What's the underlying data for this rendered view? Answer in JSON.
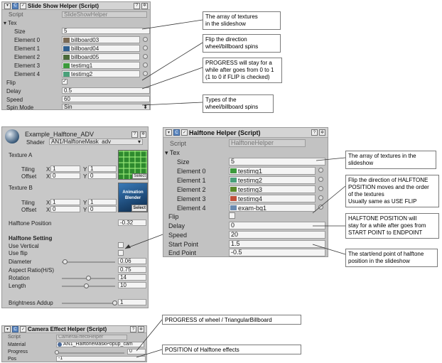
{
  "slideshow": {
    "title": "Slide Show Helper (Script)",
    "script_label": "Script",
    "script_value": "SlideShowHelper",
    "tex_label": "Tex",
    "size_label": "Size",
    "size_value": "5",
    "elements": [
      {
        "label": "Element 0",
        "value": "billboard03",
        "color": "#7b6a55"
      },
      {
        "label": "Element 1",
        "value": "billboard04",
        "color": "#2f5f8f"
      },
      {
        "label": "Element 2",
        "value": "billboard05",
        "color": "#4a6a3a"
      },
      {
        "label": "Element 3",
        "value": "testimg1",
        "color": "#3c9a3c"
      },
      {
        "label": "Element 4",
        "value": "testimg2",
        "color": "#4aa07a"
      }
    ],
    "flip_label": "Flip",
    "flip_checked": "✓",
    "delay_label": "Delay",
    "delay_value": "0.5",
    "speed_label": "Speed",
    "speed_value": "60",
    "spin_label": "Spin Mode",
    "spin_value": "Sin"
  },
  "notes_top": {
    "textures": [
      "The array of textures",
      "in the slideshow"
    ],
    "flip": [
      "Flip the direction",
      "wheel/billboard spins"
    ],
    "progress": [
      "PROGRESS will stay for a",
      "while after goes from 0 to 1",
      "(1 to 0 if FLIP is checked)"
    ],
    "types": [
      "Types of the",
      "wheel/billboard spins"
    ]
  },
  "material": {
    "name": "Example_Halftone_ADV",
    "shader_label": "Shader",
    "shader_value": "AN1/HalftoneMask_adv",
    "texA_label": "Texture A",
    "texB_label": "Texture B",
    "tiling_label": "Tiling",
    "offset_label": "Offset",
    "x_label": "X",
    "y_label": "Y",
    "texA": {
      "tiling_x": "1",
      "tiling_y": "1",
      "offset_x": "0",
      "offset_y": "0"
    },
    "texB": {
      "tiling_x": "1",
      "tiling_y": "1",
      "offset_x": "0",
      "offset_y": "0"
    },
    "select_label": "Select",
    "texB_thumb_text": "Animation Blender",
    "hp_label": "Halftone Position",
    "hp_value": "-0.32",
    "setting_label": "Halftone Setting",
    "use_vertical": "Use Vertical",
    "use_flip": "Use flip",
    "diameter_label": "Diameter",
    "diameter_value": "0.06",
    "diameter_level": 0.06,
    "aspect_label": "Aspect Ratio(H/S)",
    "aspect_value": "0.75",
    "rotation_label": "Rotation",
    "rotation_value": "14",
    "rotation_level": 0.5,
    "length_label": "Length",
    "length_value": "10",
    "length_level": 0.47,
    "brightness_label": "Brightness Addup",
    "brightness_value": "1",
    "brightness_level": 1.0
  },
  "halftone": {
    "title": "Halftone Helper (Script)",
    "script_label": "Script",
    "script_value": "HalftoneHelper",
    "tex_label": "Tex",
    "size_label": "Size",
    "size_value": "5",
    "elements": [
      {
        "label": "Element 0",
        "value": "testimg1",
        "color": "#3c9a3c"
      },
      {
        "label": "Element 1",
        "value": "testimg2",
        "color": "#4aa07a"
      },
      {
        "label": "Element 2",
        "value": "testimg3",
        "color": "#5a8a2a"
      },
      {
        "label": "Element 3",
        "value": "testimg4",
        "color": "#c0503a"
      },
      {
        "label": "Element 4",
        "value": "exam-bg1",
        "color": "#6a8ab0"
      }
    ],
    "flip_label": "Flip",
    "delay_label": "Delay",
    "delay_value": "0",
    "speed_label": "Speed",
    "speed_value": "20",
    "start_label": "Start Point",
    "start_value": "1.5",
    "end_label": "End Point",
    "end_value": "-0.5"
  },
  "notes_right": {
    "textures": [
      "The array of textures in the",
      "slideshow"
    ],
    "flip": [
      "Flip the direction of HALFTONE",
      "POSITION moves and the order",
      "of the textures",
      "Usually same as USE FLIP"
    ],
    "position": [
      "HALFTONE POSITION will",
      "stay for a while after goes from",
      "START POINT to ENDPOINT"
    ],
    "startend": [
      "The start/end point of halftone",
      "position in the slideshow"
    ]
  },
  "camera": {
    "title": "Camera Effect Helper (Script)",
    "script_label": "Script",
    "script_value": "CameraEffectHelper",
    "material_label": "Material",
    "material_value": "AN1_HalftoneMaskPopup_cam",
    "progress_label": "Progress",
    "progress_value": "0",
    "pos_label": "Pos",
    "pos_value": "-1"
  },
  "notes_bottom": {
    "progress": "PROGRESS of wheel / TriangularBillboard",
    "position": "POSITION of Halftone effects"
  }
}
